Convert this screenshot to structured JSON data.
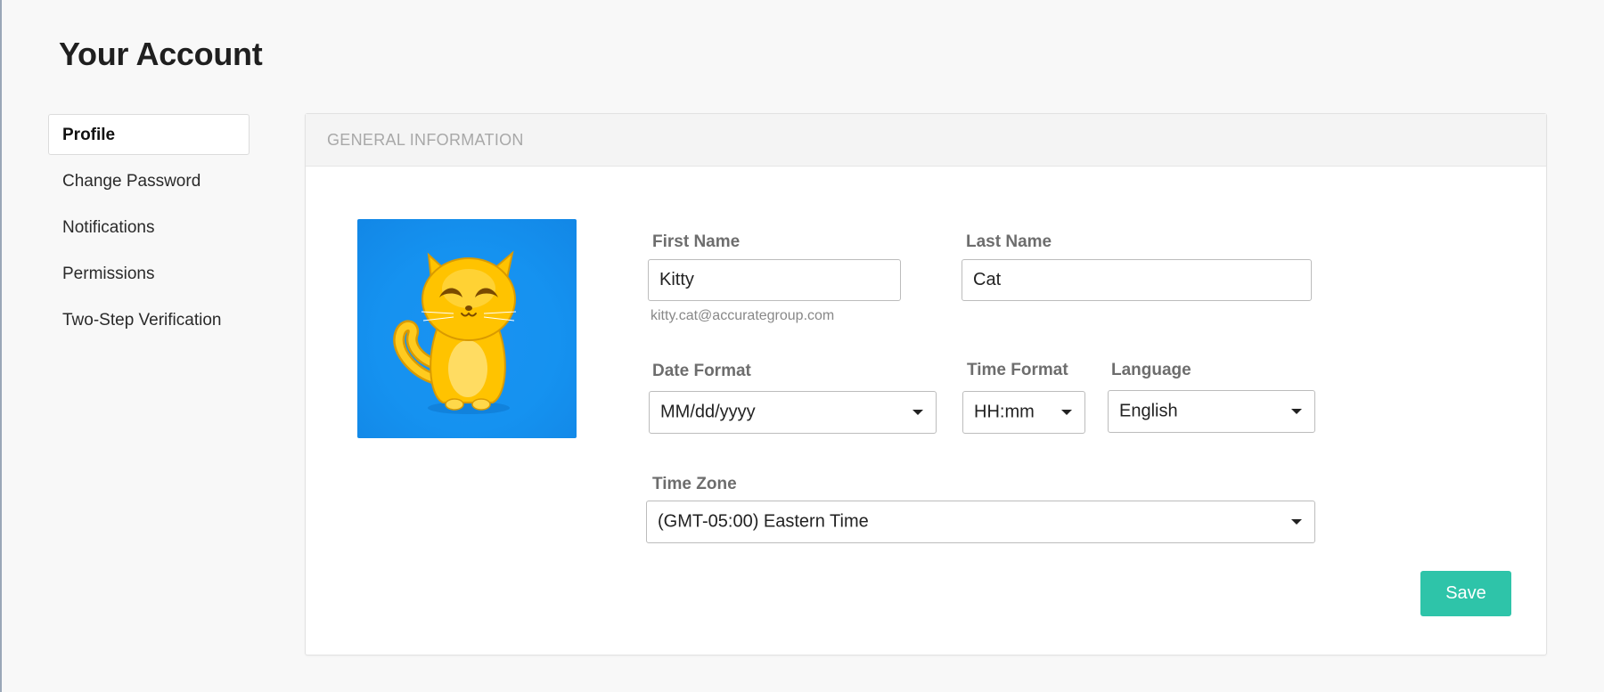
{
  "page": {
    "title": "Your Account"
  },
  "sidebar": {
    "items": [
      {
        "label": "Profile",
        "active": true
      },
      {
        "label": "Change Password",
        "active": false
      },
      {
        "label": "Notifications",
        "active": false
      },
      {
        "label": "Permissions",
        "active": false
      },
      {
        "label": "Two-Step Verification",
        "active": false
      }
    ]
  },
  "panel": {
    "header": "General Information"
  },
  "avatar": {
    "icon": "cat-avatar",
    "background_color": "#1592f0"
  },
  "form": {
    "first_name": {
      "label": "First Name",
      "value": "Kitty"
    },
    "last_name": {
      "label": "Last Name",
      "value": "Cat"
    },
    "email": "kitty.cat@accurategroup.com",
    "date_format": {
      "label": "Date Format",
      "value": "MM/dd/yyyy"
    },
    "time_format": {
      "label": "Time Format",
      "value": "HH:mm"
    },
    "language": {
      "label": "Language",
      "value": "English"
    },
    "time_zone": {
      "label": "Time Zone",
      "value": "(GMT-05:00) Eastern Time"
    }
  },
  "actions": {
    "save_label": "Save",
    "save_color": "#2ec4a9"
  }
}
